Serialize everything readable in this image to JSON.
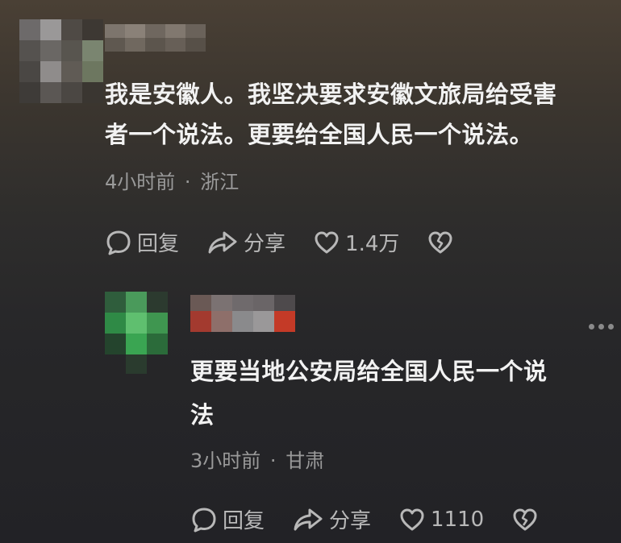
{
  "comments": [
    {
      "text_line1": "我是安徽人。我坚决要求安徽文旅局给受害",
      "text_line2": "者一个说法。更要给全国人民一个说法。",
      "time": "4小时前",
      "sep": "·",
      "location": "浙江",
      "reply_label": "回复",
      "share_label": "分享",
      "likes": "1.4万"
    },
    {
      "text_line1": "更要当地公安局给全国人民一个说",
      "text_line2": "法",
      "time": "3小时前",
      "sep": "·",
      "location": "甘肃",
      "reply_label": "回复",
      "share_label": "分享",
      "likes": "1110"
    }
  ],
  "icons": {
    "reply": "reply-bubble-icon",
    "share": "share-arrow-icon",
    "like": "heart-icon",
    "dislike": "broken-heart-icon",
    "more": "more-dots-icon"
  }
}
